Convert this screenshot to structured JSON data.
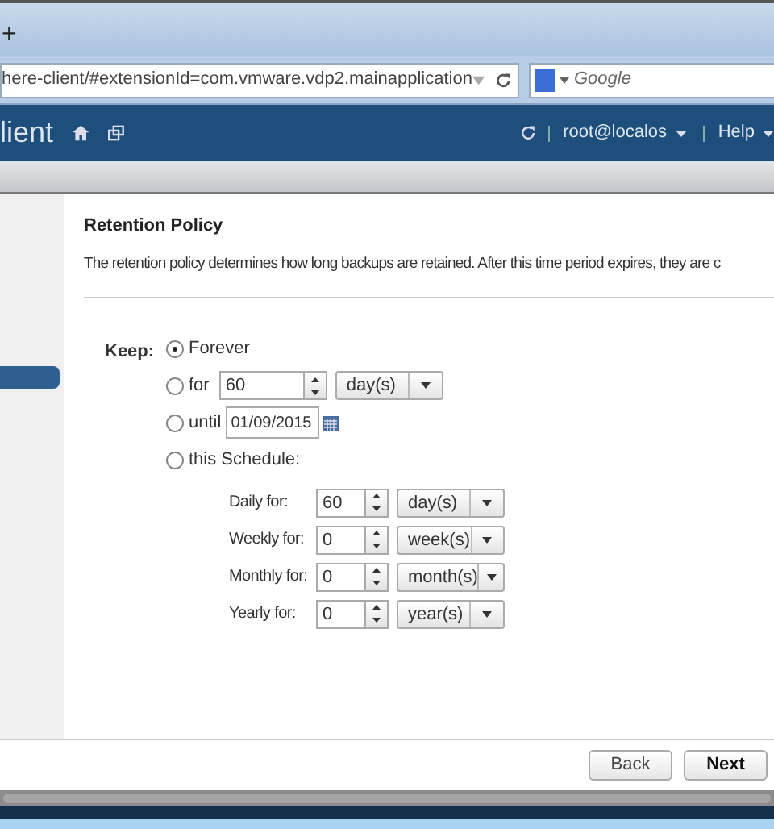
{
  "browser": {
    "new_tab": "+",
    "address": "here-client/#extensionId=com.vmware.vdp2.mainapplication",
    "search_placeholder": "Google"
  },
  "header": {
    "title": "lient",
    "user": "root@localos",
    "help": "Help"
  },
  "sidebar": {
    "items": [
      {
        "selected": true
      }
    ]
  },
  "section": {
    "title": "Retention Policy",
    "description": "The retention policy determines how long backups are retained.  After this time period expires, they are c"
  },
  "keep_label": "Keep:",
  "options": [
    {
      "kind": "plain",
      "label": "Forever",
      "selected": true
    },
    {
      "kind": "duration",
      "label": "for",
      "selected": false,
      "value": "60",
      "unit": "day(s)"
    },
    {
      "kind": "date",
      "label": "until",
      "selected": false,
      "value": "01/09/2015"
    },
    {
      "kind": "plain",
      "label": "this Schedule:",
      "selected": false
    }
  ],
  "schedule": [
    {
      "label": "Daily for:",
      "value": "60",
      "unit": "day(s)"
    },
    {
      "label": "Weekly for:",
      "value": "0",
      "unit": "week(s)"
    },
    {
      "label": "Monthly for:",
      "value": "0",
      "unit": "month(s)"
    },
    {
      "label": "Yearly for:",
      "value": "0",
      "unit": "year(s)"
    }
  ],
  "buttons": [
    {
      "kind": "secondary",
      "label": "Back"
    },
    {
      "kind": "primary",
      "label": "Next"
    }
  ]
}
